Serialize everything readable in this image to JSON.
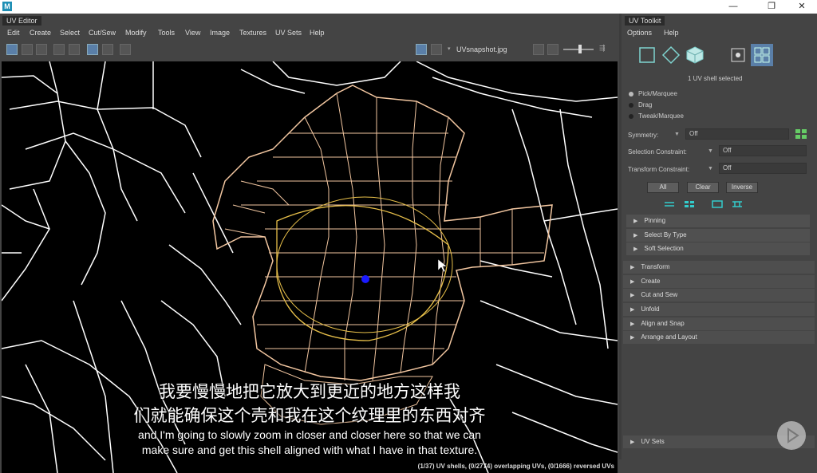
{
  "window": {
    "logo": "M",
    "controls": {
      "minimize": "—",
      "restore": "❐",
      "close": "✕"
    }
  },
  "uv_editor": {
    "tab": "UV Editor",
    "menu": [
      "Edit",
      "Create",
      "Select",
      "Cut/Sew",
      "Modify",
      "Tools",
      "View",
      "Image",
      "Textures",
      "UV Sets",
      "Help"
    ],
    "image_name": "UVsnapshot.jpg",
    "subtitle_cn_1": "我要慢慢地把它放大到更近的地方这样我",
    "subtitle_cn_2": "们就能确保这个壳和我在这个纹理里的东西对齐",
    "subtitle_en_1": "and I'm going to slowly zoom in closer and closer here so that we can",
    "subtitle_en_2": "make sure and get this shell aligned with what I have in that texture.",
    "status": "(1/37) UV shells, (0/2774) overlapping UVs, (0/1666) reversed UVs"
  },
  "toolkit": {
    "tab": "UV Toolkit",
    "menu": [
      "Options",
      "Help"
    ],
    "shell_selected": "1 UV shell selected",
    "modes": [
      "Pick/Marquee",
      "Drag",
      "Tweak/Marquee"
    ],
    "symmetry_label": "Symmetry:",
    "symmetry_value": "Off",
    "selection_constraint_label": "Selection Constraint:",
    "selection_constraint_value": "Off",
    "transform_constraint_label": "Transform Constraint:",
    "transform_constraint_value": "Off",
    "buttons": [
      "All",
      "Clear",
      "Inverse"
    ],
    "subsections": [
      "Pinning",
      "Select By Type",
      "Soft Selection"
    ],
    "sections": [
      "Transform",
      "Create",
      "Cut and Sew",
      "Unfold",
      "Align and Snap",
      "Arrange and Layout"
    ],
    "uv_sets": "UV Sets"
  },
  "colors": {
    "accent": "#5a7fa8",
    "uv_mesh": "#f2c6a0",
    "wireframe": "#ffffff",
    "pivot": "#1a1aff",
    "soft_selection": "#e8c04a"
  }
}
